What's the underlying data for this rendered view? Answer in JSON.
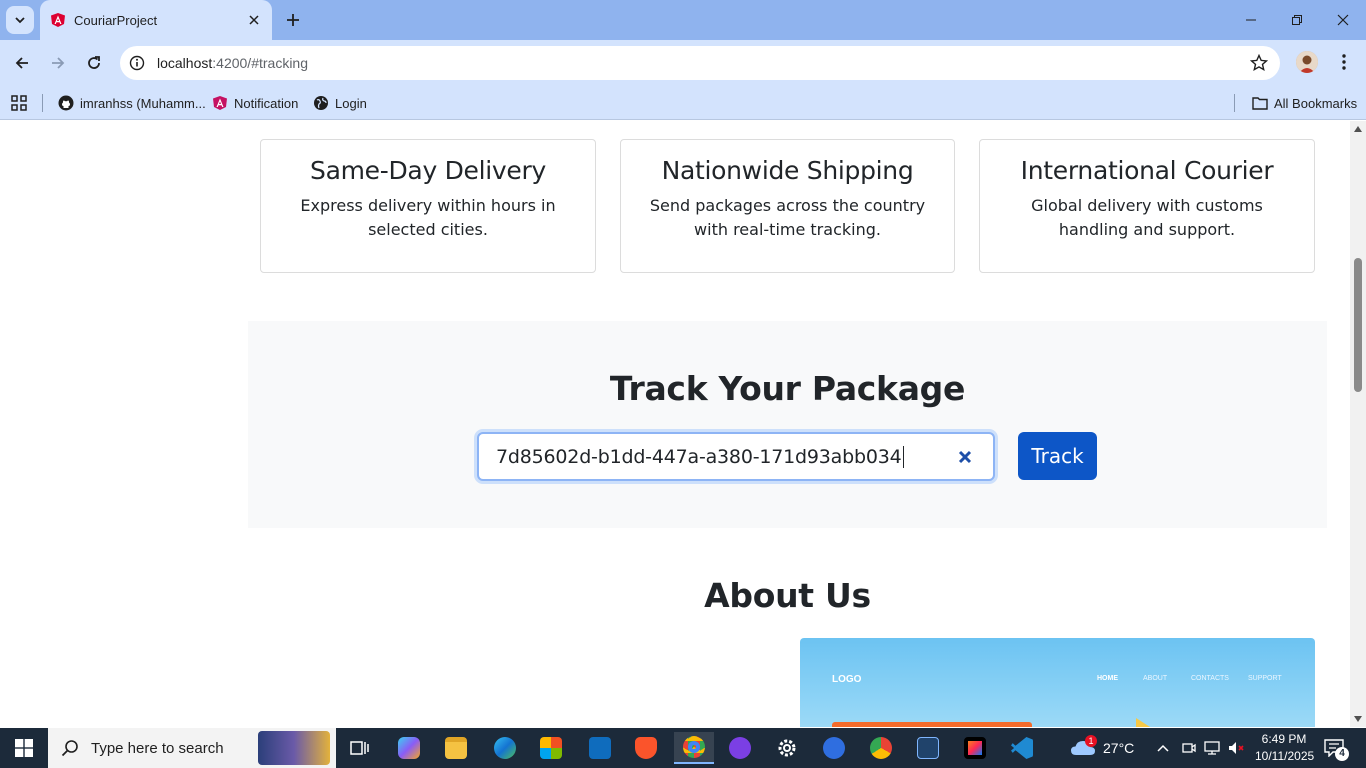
{
  "browser": {
    "tab_title": "CouriarProject",
    "url_host": "localhost",
    "url_path": ":4200/#tracking",
    "bookmarks": [
      {
        "label": "imranhss (Muhamm...",
        "icon": "github-icon"
      },
      {
        "label": "Notification",
        "icon": "angular-icon"
      },
      {
        "label": "Login",
        "icon": "globe-icon"
      }
    ],
    "all_bookmarks_label": "All Bookmarks"
  },
  "services": [
    {
      "title": "Same-Day Delivery",
      "description": "Express delivery within hours in selected cities."
    },
    {
      "title": "Nationwide Shipping",
      "description": "Send packages across the country with real-time tracking."
    },
    {
      "title": "International Courier",
      "description": "Global delivery with customs handling and support."
    }
  ],
  "tracking": {
    "title": "Track Your Package",
    "input_value": "7d85602d-b1dd-447a-a380-171d93abb034",
    "button_label": "Track"
  },
  "about": {
    "title": "About Us",
    "image": {
      "logo": "LOGO",
      "nav": [
        "HOME",
        "ABOUT",
        "CONTACTS",
        "SUPPORT"
      ]
    }
  },
  "taskbar": {
    "search_placeholder": "Type here to search",
    "weather": "27°C",
    "weather_badge": "1",
    "time": "6:49 PM",
    "date": "10/11/2025",
    "notification_count": "4"
  },
  "colors": {
    "accent": "#0d56c7",
    "chrome": "#d3e3fd",
    "tabstrip": "#8fb3ee",
    "section_bg": "#f8f9fa"
  }
}
